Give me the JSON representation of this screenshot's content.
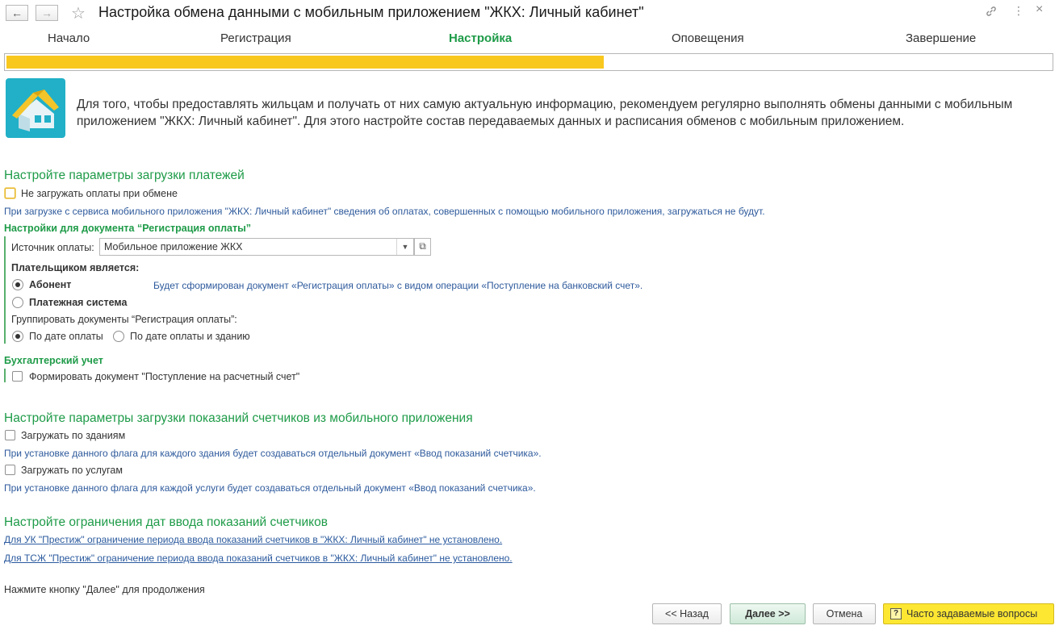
{
  "window": {
    "title": "Настройка обмена данными с мобильным приложением \"ЖКХ: Личный кабинет\""
  },
  "steps": [
    "Начало",
    "Регистрация",
    "Настройка",
    "Оповещения",
    "Завершение"
  ],
  "progress": {
    "fraction": 0.57
  },
  "intro_text": "Для того, чтобы предоставлять жильцам и получать от них самую актуальную информацию, рекомендуем регулярно выполнять обмены данными с мобильным приложением \"ЖКХ: Личный кабинет\". Для этого настройте состав передаваемых данных и расписания обменов с мобильным приложением.",
  "payments": {
    "header": "Настройте параметры загрузки платежей",
    "no_load_label": "Не загружать оплаты при обмене",
    "info": "При загрузке с сервиса мобильного приложения \"ЖКХ: Личный кабинет\" сведения об оплатах, совершенных с помощью мобильного приложения, загружаться не будут.",
    "doc_header": "Настройки для документа “Регистрация оплаты”",
    "source_label": "Источник оплаты:",
    "source_value": "Мобильное приложение ЖКХ",
    "payer_label": "Плательщиком является:",
    "payer_options": [
      "Абонент",
      "Платежная система"
    ],
    "payer_info": "Будет сформирован документ «Регистрация оплаты» с видом операции «Поступление на банковский счет».",
    "group_label": "Группировать документы “Регистрация оплаты”:",
    "group_options": [
      "По дате оплаты",
      "По дате оплаты и зданию"
    ],
    "accounting_header": "Бухгалтерский учет",
    "form_doc_label": "Формировать документ \"Поступление на расчетный счет\""
  },
  "meters": {
    "header": "Настройте параметры загрузки показаний счетчиков из мобильного приложения",
    "by_building_label": "Загружать по зданиям",
    "by_building_info": "При установке данного флага для каждого здания будет создаваться отдельный документ «Ввод показаний счетчика».",
    "by_service_label": "Загружать по услугам",
    "by_service_info": "При установке данного флага для каждой услуги будет создаваться отдельный документ «Ввод показаний счетчика»."
  },
  "limits": {
    "header": "Настройте ограничения дат ввода показаний счетчиков",
    "links": [
      "Для УК \"Престиж\" ограничение периода ввода показаний счетчиков в \"ЖКХ: Личный кабинет\" не установлено.",
      "Для ТСЖ \"Престиж\" ограничение периода ввода показаний счетчиков в \"ЖКХ: Личный кабинет\" не установлено."
    ]
  },
  "footer_hint": "Нажмите кнопку \"Далее\" для продолжения",
  "buttons": {
    "back": "<< Назад",
    "next": "Далее >>",
    "cancel": "Отмена",
    "faq": "Часто задаваемые вопросы",
    "faq_icon_glyph": "?"
  },
  "colors": {
    "accent_green": "#1e9b48",
    "progress_yellow": "#f9c81f",
    "link_blue": "#2b5a9e",
    "faq_yellow": "#fde733"
  }
}
